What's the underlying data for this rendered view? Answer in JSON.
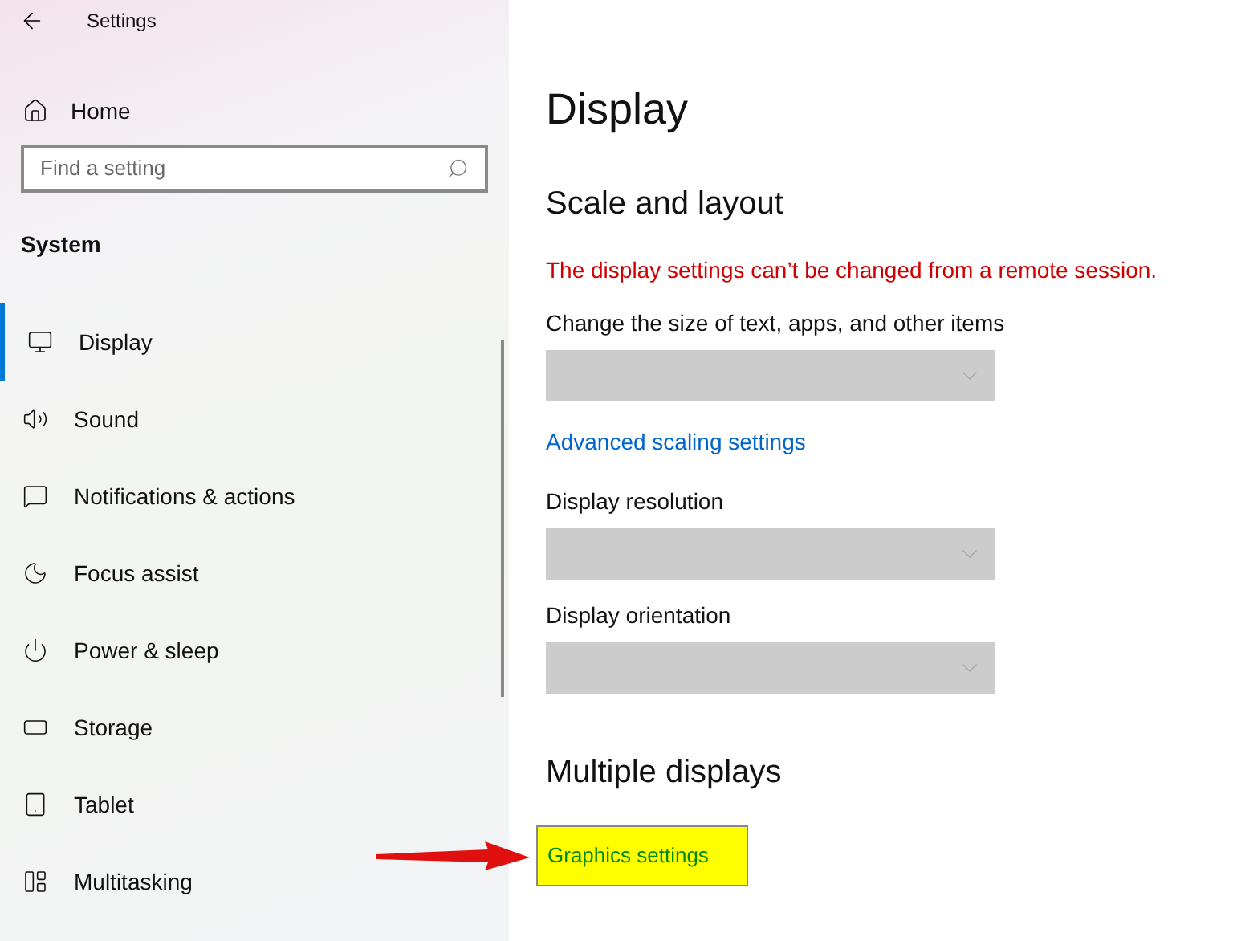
{
  "window": {
    "title": "Settings"
  },
  "home": {
    "label": "Home"
  },
  "search": {
    "placeholder": "Find a setting"
  },
  "section": "System",
  "sidebar": {
    "items": [
      {
        "label": "Display",
        "kind": "display",
        "selected": true
      },
      {
        "label": "Sound",
        "kind": "sound",
        "selected": false
      },
      {
        "label": "Notifications & actions",
        "kind": "notifications",
        "selected": false
      },
      {
        "label": "Focus assist",
        "kind": "focus",
        "selected": false
      },
      {
        "label": "Power & sleep",
        "kind": "power",
        "selected": false
      },
      {
        "label": "Storage",
        "kind": "storage",
        "selected": false
      },
      {
        "label": "Tablet",
        "kind": "tablet",
        "selected": false
      },
      {
        "label": "Multitasking",
        "kind": "multitasking",
        "selected": false
      }
    ]
  },
  "page": {
    "title": "Display",
    "sections": [
      {
        "heading": "Scale and layout",
        "items": [
          {
            "kind": "warning",
            "text": "The display settings can’t be changed from a remote session."
          },
          {
            "kind": "label",
            "text": "Change the size of text, apps, and other items"
          },
          {
            "kind": "dropdown",
            "disabled": true
          },
          {
            "kind": "link",
            "text": "Advanced scaling settings"
          },
          {
            "kind": "label",
            "text": "Display resolution"
          },
          {
            "kind": "dropdown",
            "disabled": true
          },
          {
            "kind": "label",
            "text": "Display orientation"
          },
          {
            "kind": "dropdown",
            "disabled": true
          }
        ]
      },
      {
        "heading": "Multiple displays",
        "items": [
          {
            "kind": "highlighted_link",
            "text": "Graphics settings"
          }
        ]
      }
    ]
  }
}
